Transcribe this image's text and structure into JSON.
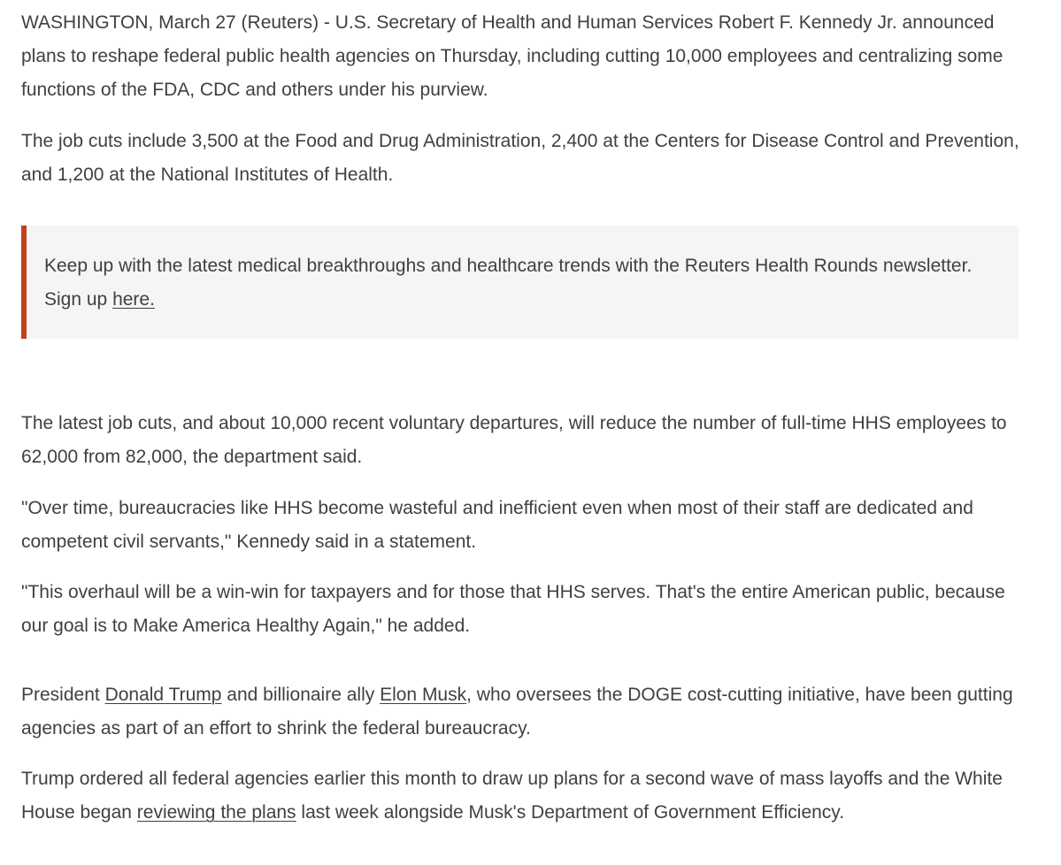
{
  "article": {
    "p1": "WASHINGTON, March 27 (Reuters) - U.S. Secretary of Health and Human Services Robert F. Kennedy Jr. announced plans to reshape federal public health agencies on Thursday, including cutting 10,000 employees and centralizing some functions of the FDA, CDC and others under his purview.",
    "p2": "The job cuts include 3,500 at the Food and Drug Administration, 2,400 at the Centers for Disease Control and Prevention, and 1,200 at the National Institutes of Health.",
    "newsletter": {
      "text": "Keep up with the latest medical breakthroughs and healthcare trends with the Reuters Health Rounds newsletter. Sign up ",
      "link": "here.",
      "accent_color": "#c1411e"
    },
    "p3": "The latest job cuts, and about 10,000 recent voluntary departures, will reduce the number of full-time HHS employees to 62,000 from 82,000, the department said.",
    "p4": "\"Over time, bureaucracies like HHS become wasteful and inefficient even when most of their staff are dedicated and competent civil servants,\" Kennedy said in a statement.",
    "p5": "\"This overhaul will be a win-win for taxpayers and for those that HHS serves. That's the entire American public, because our goal is to Make America Healthy Again,\" he added.",
    "p6": {
      "t1": "President ",
      "link1": "Donald Trump",
      "t2": " and billionaire ally ",
      "link2": "Elon Musk",
      "t3": ", who oversees the DOGE cost-cutting initiative, have been gutting agencies as part of an effort to shrink the federal bureaucracy."
    },
    "p7": {
      "t1": "Trump ordered all federal agencies earlier this month to draw up plans for a second wave of mass layoffs and the White House began ",
      "link": "reviewing the plans",
      "t2": " last week alongside Musk's Department of Government Efficiency."
    }
  }
}
